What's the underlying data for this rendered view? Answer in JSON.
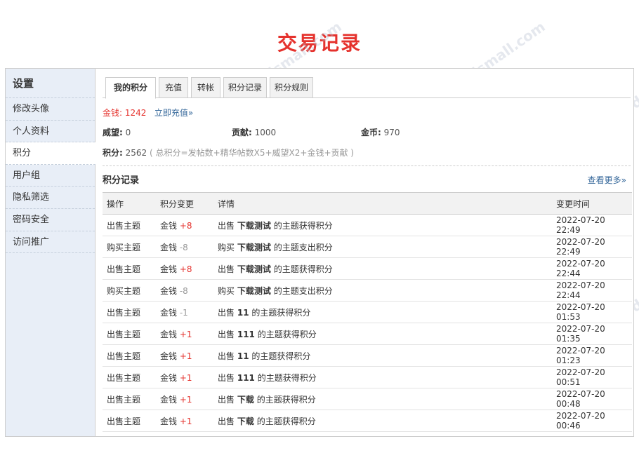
{
  "page_title": "交易记录",
  "sidebar": {
    "title": "设置",
    "items": [
      {
        "label": "修改头像"
      },
      {
        "label": "个人资料"
      },
      {
        "label": "积分"
      },
      {
        "label": "用户组"
      },
      {
        "label": "隐私筛选"
      },
      {
        "label": "密码安全"
      },
      {
        "label": "访问推广"
      }
    ]
  },
  "tabs": [
    "我的积分",
    "充值",
    "转帐",
    "积分记录",
    "积分规则"
  ],
  "summary": {
    "gold_label": "金钱:",
    "gold_value": "1242",
    "recharge_link": "立即充值»",
    "prestige_label": "威望:",
    "prestige_value": "0",
    "contribution_label": "贡献:",
    "contribution_value": "1000",
    "coin_label": "金币:",
    "coin_value": "970",
    "total_label": "积分:",
    "total_value": "2562",
    "total_formula": "( 总积分=发帖数+精华帖数X5+威望X2+金钱+贡献 )"
  },
  "log": {
    "title": "积分记录",
    "more_link": "查看更多»",
    "columns": [
      "操作",
      "积分变更",
      "详情",
      "变更时间"
    ],
    "rows": [
      {
        "action": "出售主题",
        "currency": "金钱",
        "delta": "+8",
        "positive": true,
        "verb": "出售",
        "subject": "下载测试",
        "tail": "的主题获得积分",
        "time": "2022-07-20 22:49"
      },
      {
        "action": "购买主题",
        "currency": "金钱",
        "delta": "-8",
        "positive": false,
        "verb": "购买",
        "subject": "下载测试",
        "tail": "的主题支出积分",
        "time": "2022-07-20 22:49"
      },
      {
        "action": "出售主题",
        "currency": "金钱",
        "delta": "+8",
        "positive": true,
        "verb": "出售",
        "subject": "下载测试",
        "tail": "的主题获得积分",
        "time": "2022-07-20 22:44"
      },
      {
        "action": "购买主题",
        "currency": "金钱",
        "delta": "-8",
        "positive": false,
        "verb": "购买",
        "subject": "下载测试",
        "tail": "的主题支出积分",
        "time": "2022-07-20 22:44"
      },
      {
        "action": "出售主题",
        "currency": "金钱",
        "delta": "-1",
        "positive": false,
        "verb": "出售",
        "subject": "11",
        "tail": "的主题获得积分",
        "time": "2022-07-20 01:53"
      },
      {
        "action": "出售主题",
        "currency": "金钱",
        "delta": "+1",
        "positive": true,
        "verb": "出售",
        "subject": "111",
        "tail": "的主题获得积分",
        "time": "2022-07-20 01:35"
      },
      {
        "action": "出售主题",
        "currency": "金钱",
        "delta": "+1",
        "positive": true,
        "verb": "出售",
        "subject": "11",
        "tail": "的主题获得积分",
        "time": "2022-07-20 01:23"
      },
      {
        "action": "出售主题",
        "currency": "金钱",
        "delta": "+1",
        "positive": true,
        "verb": "出售",
        "subject": "111",
        "tail": "的主题获得积分",
        "time": "2022-07-20 00:51"
      },
      {
        "action": "出售主题",
        "currency": "金钱",
        "delta": "+1",
        "positive": true,
        "verb": "出售",
        "subject": "下载",
        "tail": "的主题获得积分",
        "time": "2022-07-20 00:48"
      },
      {
        "action": "出售主题",
        "currency": "金钱",
        "delta": "+1",
        "positive": true,
        "verb": "出售",
        "subject": "下载",
        "tail": "的主题获得积分",
        "time": "2022-07-20 00:46"
      }
    ]
  },
  "watermark": "DISCUZ!应用中心 | 贰道 addon.dismall.com"
}
